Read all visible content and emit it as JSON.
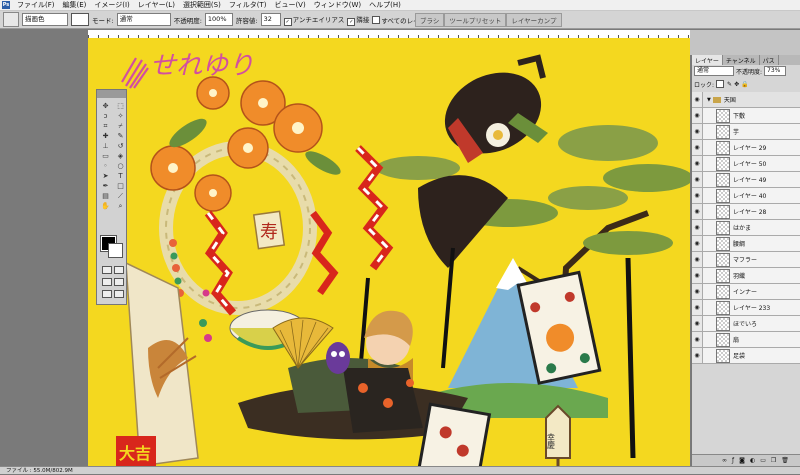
{
  "menubar": {
    "items": [
      "ファイル(F)",
      "編集(E)",
      "イメージ(I)",
      "レイヤー(L)",
      "選択範囲(S)",
      "フィルタ(T)",
      "ビュー(V)",
      "ウィンドウ(W)",
      "ヘルプ(H)"
    ]
  },
  "options": {
    "fill_source": "描画色",
    "mode_label": "モード:",
    "mode_value": "通常",
    "opacity_label": "不透明度:",
    "opacity_value": "100%",
    "tolerance_label": "許容値:",
    "tolerance_value": "32",
    "antialias_label": "アンチエイリアス",
    "contiguous_label": "隣接",
    "all_layers_label": "すべてのレイヤー",
    "panel_tabs": [
      "ブラシ",
      "ツールプリセット",
      "レイヤーカンプ"
    ]
  },
  "canvas": {
    "background_color": "#f4d81f",
    "signature_text": "せれゆり",
    "signature_color": "#d24fa0",
    "artwork_text_kotobuki": "寿",
    "artwork_text_koukei": "幸慶",
    "artwork_text_daikichi": "大吉"
  },
  "tools_panel": {
    "foreground_color": "#000000",
    "background_color": "#ffffff"
  },
  "layers_panel": {
    "tabs": [
      "レイヤー",
      "チャンネル",
      "パス"
    ],
    "blend_mode": "通常",
    "opacity_label": "不透明度:",
    "opacity_value": "73%",
    "lock_label": "ロック:",
    "group_name": "天国",
    "layers": [
      "下敷",
      "芋",
      "レイヤー 29",
      "レイヤー 50",
      "レイヤー 49",
      "レイヤー 40",
      "レイヤー 28",
      "はかま",
      "腰綱",
      "マフラー",
      "羽織",
      "インナー",
      "レイヤー 233",
      "ほでいろ",
      "扇",
      "足袋"
    ]
  },
  "statusbar": {
    "text": "ファイル : 55.0M/802.9M"
  }
}
